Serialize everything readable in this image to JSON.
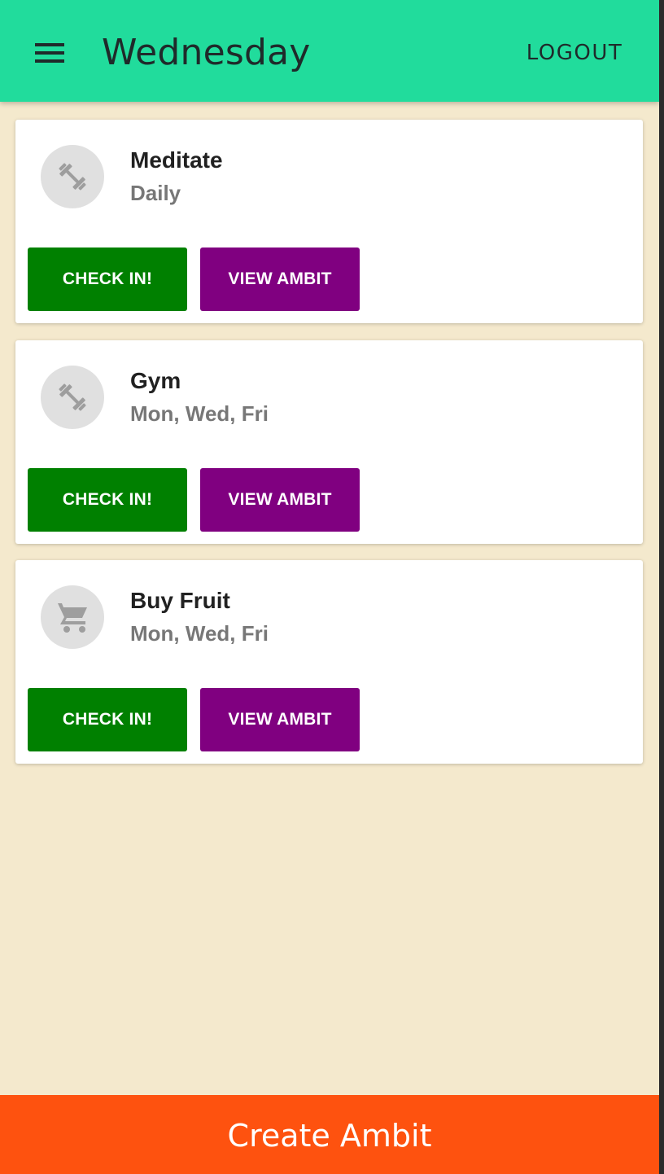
{
  "app": {
    "title": "Wednesday",
    "logout_label": "LOGOUT",
    "menu_icon": "menu-icon"
  },
  "colors": {
    "appbar": "#21dc9c",
    "background": "#f4e9cd",
    "check_in": "#008000",
    "view_ambit": "#800080",
    "create_bar": "#fe520f"
  },
  "ambits": [
    {
      "name": "Meditate",
      "frequency": "Daily",
      "icon": "dumbbell-icon",
      "check_in_label": "CHECK IN!",
      "view_label": "VIEW AMBIT"
    },
    {
      "name": "Gym",
      "frequency": "Mon, Wed, Fri",
      "icon": "dumbbell-icon",
      "check_in_label": "CHECK IN!",
      "view_label": "VIEW AMBIT"
    },
    {
      "name": "Buy Fruit",
      "frequency": "Mon, Wed, Fri",
      "icon": "shopping-cart-icon",
      "check_in_label": "CHECK IN!",
      "view_label": "VIEW AMBIT"
    }
  ],
  "footer": {
    "create_label": "Create Ambit"
  }
}
